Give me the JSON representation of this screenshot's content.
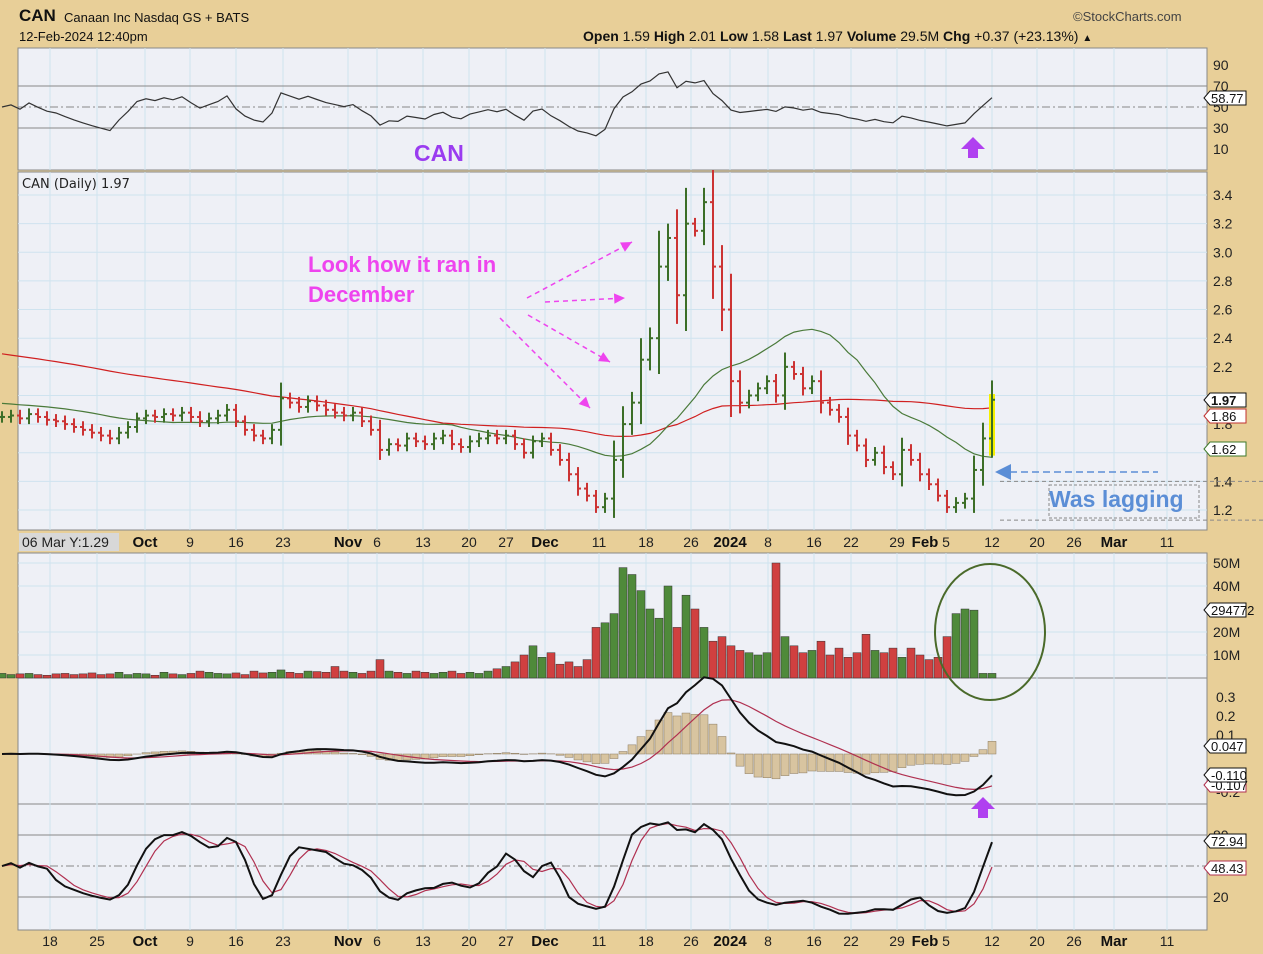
{
  "header": {
    "symbol": "CAN",
    "company": "Canaan Inc Nasdaq GS + BATS",
    "datetime": "12-Feb-2024 12:40pm",
    "copyright": "©StockCharts.com",
    "open_label": "Open",
    "open": "1.59",
    "high_label": "High",
    "high": "2.01",
    "low_label": "Low",
    "low": "1.58",
    "last_label": "Last",
    "last": "1.97",
    "volume_label": "Volume",
    "volume": "29.5M",
    "chg_label": "Chg",
    "chg": "+0.37 (+23.13%)"
  },
  "colors": {
    "up": "#3c6e27",
    "down": "#cc3333",
    "sma_long": "#d02020",
    "sma_short": "#4a7a3a",
    "background": "#e8cf98",
    "panel": "#eef0f6"
  },
  "chart_data": [
    {
      "type": "ohlc",
      "title": "CAN (Daily) 1.97",
      "closes": [
        1.85,
        1.86,
        1.84,
        1.87,
        1.85,
        1.83,
        1.82,
        1.8,
        1.78,
        1.76,
        1.74,
        1.72,
        1.7,
        1.74,
        1.78,
        1.84,
        1.86,
        1.85,
        1.87,
        1.86,
        1.88,
        1.85,
        1.82,
        1.84,
        1.86,
        1.9,
        1.82,
        1.76,
        1.72,
        1.7,
        1.76,
        1.98,
        1.95,
        1.92,
        1.96,
        1.93,
        1.9,
        1.88,
        1.86,
        1.88,
        1.82,
        1.76,
        1.62,
        1.66,
        1.65,
        1.7,
        1.68,
        1.66,
        1.7,
        1.72,
        1.66,
        1.64,
        1.68,
        1.7,
        1.72,
        1.7,
        1.72,
        1.66,
        1.6,
        1.68,
        1.7,
        1.62,
        1.55,
        1.45,
        1.35,
        1.3,
        1.22,
        1.28,
        1.55,
        1.8,
        1.95,
        2.25,
        2.4,
        2.9,
        3.1,
        2.7,
        3.2,
        3.15,
        3.35,
        2.9,
        2.6,
        2.1,
        1.95,
        2.0,
        2.05,
        2.1,
        2.0,
        2.2,
        2.15,
        2.05,
        2.1,
        1.95,
        1.9,
        1.85,
        1.72,
        1.65,
        1.55,
        1.6,
        1.5,
        1.45,
        1.62,
        1.55,
        1.45,
        1.38,
        1.3,
        1.22,
        1.25,
        1.28,
        1.48,
        1.7,
        1.97
      ],
      "volume_millions": [
        2,
        1.5,
        1.8,
        2,
        1.5,
        1.2,
        1.8,
        2,
        1.5,
        1.8,
        2.2,
        1.5,
        1.8,
        2.5,
        1.5,
        2,
        1.8,
        1.2,
        2.5,
        1.8,
        1.5,
        2,
        3,
        2.5,
        2,
        1.8,
        2.2,
        1.5,
        3,
        2.2,
        2.5,
        3.5,
        2.5,
        2,
        3,
        2.8,
        2.5,
        5,
        3,
        2.5,
        2,
        3,
        8,
        3,
        2.5,
        2,
        3,
        2.5,
        2,
        2.5,
        3,
        2,
        2.5,
        2,
        3,
        4,
        5,
        7,
        10,
        14,
        9,
        11,
        6,
        7,
        5,
        8,
        22,
        24,
        28,
        48,
        45,
        38,
        30,
        26,
        40,
        22,
        36,
        30,
        22,
        16,
        18,
        14,
        12,
        11,
        10,
        11,
        50,
        18,
        14,
        11,
        12,
        16,
        10,
        13,
        9,
        11,
        19,
        12,
        11,
        13,
        9,
        13,
        10,
        8,
        9,
        18,
        28,
        30,
        29.5
      ],
      "yticks": [
        "3.4",
        "3.2",
        "3.0",
        "2.8",
        "2.6",
        "2.4",
        "2.2",
        "1.8",
        "1.4",
        "1.2"
      ],
      "ylim": [
        1.1,
        3.55
      ],
      "last_tags": [
        "1.97",
        "1.86",
        "1.62"
      ]
    },
    {
      "type": "line",
      "title": "RSI",
      "yticks": [
        "90",
        "70",
        "50",
        "30",
        "10"
      ],
      "last_tag": "58.77"
    },
    {
      "type": "bar",
      "title": "Volume",
      "yticks": [
        "50M",
        "40M",
        "20M",
        "10M"
      ],
      "last_tag": "294772"
    },
    {
      "type": "line",
      "title": "MACD",
      "yticks": [
        "0.3",
        "0.2",
        "0.1",
        "-0.2"
      ],
      "last_tags": [
        "0.047",
        "-0.110",
        "-0.107"
      ]
    },
    {
      "type": "line",
      "title": "Stochastics",
      "yticks": [
        "80",
        "20"
      ],
      "last_tags": [
        "72.94",
        "48.43"
      ]
    }
  ],
  "xaxis": {
    "date_box": "06 Mar Y:1.29",
    "labels": [
      "18",
      "25",
      "Oct",
      "9",
      "16",
      "23",
      "Nov",
      "6",
      "13",
      "20",
      "27",
      "Dec",
      "11",
      "18",
      "26",
      "2024",
      "8",
      "16",
      "22",
      "29",
      "Feb",
      "5",
      "12",
      "20",
      "26",
      "Mar",
      "11"
    ]
  },
  "annotations": {
    "can_label": "CAN",
    "ran_line1": "Look how it ran in",
    "ran_line2": "December",
    "lagging": "Was lagging"
  }
}
